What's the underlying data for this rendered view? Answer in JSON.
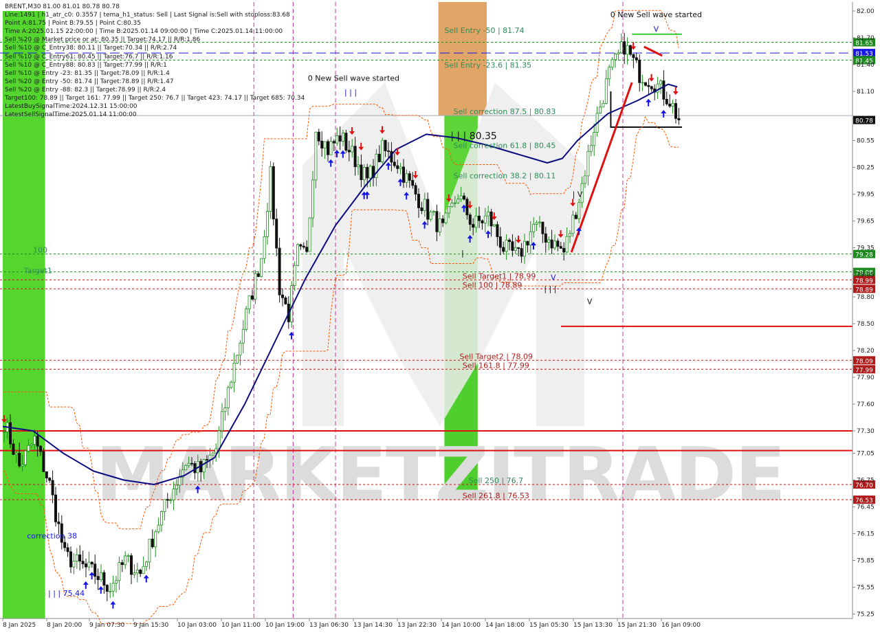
{
  "header": {
    "symbol_line": "BRENT,M30  81.00 81.01 80.78 80.78",
    "info_lines": [
      "Line:1491  |  h1_atr_c0: 0.3557  |  tema_h1_status: Sell  |  Last Signal is:Sell with stoploss:83.68",
      "Point A:81.75  |  Point B:79.55  |  Point C:80.35",
      "Time A:2025.01.15 22:00:00  |  Time B:2025.01.14 09:00:00  |  Time C:2025.01.14 11:00:00",
      "Sell %20 @ Market price or at: 80.35  ||  Target:74.17  ||  R/R:1.86",
      "Sell %10 @ C_Entry38: 80.11  ||  Target:70.34  ||  R/R:2.74",
      "Sell %10 @ C_Entry61: 80.45  ||  Target:76.7  ||  R/R:1.16",
      "Sell %10 @ C_Entry88: 80.83  ||  Target:77.99  ||  R/R:1",
      "Sell %10 @ Entry -23: 81.35  ||  Target:78.09  ||  R/R:1.4",
      "Sell %20 @ Entry -50: 81.74  ||  Target:78.89  ||  R/R:1.47",
      "Sell %20 @ Entry -88: 82.3  ||  Target:78.99  ||  R/R:2.4",
      "Target100: 78.89  ||  Target 161: 77.99  ||  Target 250: 76.7  ||  Target 423: 74.17  ||  Target 685: 70.34",
      "LatestBuySignalTime:2024.12.31 15:00:00",
      "LatestSellSignalTime:2025.01.14 11:00:00"
    ]
  },
  "chart_data": {
    "type": "candlestick",
    "symbol": "BRENT",
    "timeframe": "M30",
    "ylim": [
      75.2,
      82.1
    ],
    "y_ticks": [
      82.0,
      81.7,
      81.4,
      81.1,
      80.8,
      80.55,
      80.25,
      79.95,
      79.65,
      79.35,
      79.05,
      78.8,
      78.5,
      78.2,
      77.9,
      77.6,
      77.3,
      77.05,
      76.75,
      76.45,
      76.15,
      75.85,
      75.55,
      75.25
    ],
    "x_labels": [
      "8 Jan 2025",
      "8 Jan 20:00",
      "9 Jan 07:30",
      "9 Jan 15:30",
      "10 Jan 03:00",
      "10 Jan 11:00",
      "10 Jan 19:00",
      "13 Jan 06:30",
      "13 Jan 14:30",
      "13 Jan 22:30",
      "14 Jan 10:00",
      "14 Jan 18:00",
      "15 Jan 05:30",
      "15 Jan 13:30",
      "15 Jan 21:30",
      "16 Jan 09:00"
    ],
    "close_path": [
      [
        0,
        77.4
      ],
      [
        5,
        76.9
      ],
      [
        10,
        77.2
      ],
      [
        15,
        76.7
      ],
      [
        20,
        75.9
      ],
      [
        25,
        75.8
      ],
      [
        30,
        75.7
      ],
      [
        35,
        75.55
      ],
      [
        40,
        75.85
      ],
      [
        45,
        75.7
      ],
      [
        50,
        76.2
      ],
      [
        55,
        76.6
      ],
      [
        60,
        76.95
      ],
      [
        65,
        76.85
      ],
      [
        70,
        77.1
      ],
      [
        75,
        77.9
      ],
      [
        80,
        78.6
      ],
      [
        85,
        79.25
      ],
      [
        88,
        80.15
      ],
      [
        91,
        78.9
      ],
      [
        94,
        78.6
      ],
      [
        97,
        79.3
      ],
      [
        100,
        79.25
      ],
      [
        103,
        80.7
      ],
      [
        107,
        80.45
      ],
      [
        111,
        80.6
      ],
      [
        115,
        80.4
      ],
      [
        120,
        80.1
      ],
      [
        125,
        80.45
      ],
      [
        130,
        80.3
      ],
      [
        135,
        80.0
      ],
      [
        140,
        79.75
      ],
      [
        145,
        79.55
      ],
      [
        150,
        79.95
      ],
      [
        155,
        79.6
      ],
      [
        160,
        79.7
      ],
      [
        165,
        79.35
      ],
      [
        170,
        79.25
      ],
      [
        175,
        79.6
      ],
      [
        180,
        79.45
      ],
      [
        185,
        79.3
      ],
      [
        190,
        79.9
      ],
      [
        195,
        80.7
      ],
      [
        200,
        81.3
      ],
      [
        205,
        81.62
      ],
      [
        210,
        81.3
      ],
      [
        215,
        81.2
      ],
      [
        220,
        81.0
      ],
      [
        223,
        80.78
      ]
    ],
    "trend_line": [
      [
        0,
        77.35
      ],
      [
        10,
        77.3
      ],
      [
        20,
        77.05
      ],
      [
        30,
        76.85
      ],
      [
        40,
        76.75
      ],
      [
        50,
        76.7
      ],
      [
        60,
        76.8
      ],
      [
        70,
        77.0
      ],
      [
        80,
        77.6
      ],
      [
        90,
        78.3
      ],
      [
        100,
        79.0
      ],
      [
        110,
        79.6
      ],
      [
        120,
        80.05
      ],
      [
        130,
        80.45
      ],
      [
        140,
        80.62
      ],
      [
        150,
        80.58
      ],
      [
        160,
        80.5
      ],
      [
        170,
        80.4
      ],
      [
        180,
        80.3
      ],
      [
        185,
        80.35
      ],
      [
        190,
        80.55
      ],
      [
        200,
        80.85
      ],
      [
        210,
        81.0
      ],
      [
        220,
        81.18
      ],
      [
        223,
        81.15
      ]
    ],
    "zones": [
      {
        "kind": "buy-zone",
        "from_bar": 0,
        "to_bar": 14,
        "bottom": 75.2,
        "top": 82.0,
        "color": "#4cd423"
      },
      {
        "kind": "entry-zone",
        "from_bar": 144,
        "to_bar": 160,
        "bottom": 80.83,
        "top": 82.1,
        "color": "#e0a060"
      },
      {
        "kind": "target-zone",
        "from_bar": 146,
        "to_bar": 157,
        "bottom": 76.53,
        "top": 80.83,
        "color": "#44cc22"
      }
    ],
    "horizontal_lines": [
      {
        "price": 81.65,
        "label": "81.65",
        "color": "#1c8a1c",
        "style": "dotted"
      },
      {
        "price": 81.53,
        "label": "81.53",
        "color": "#1515e6",
        "style": "dashed"
      },
      {
        "price": 81.45,
        "label": "81.45",
        "color": "#1c8a1c",
        "style": "dotted"
      },
      {
        "price": 80.83,
        "label": "",
        "color": "#99aabb",
        "style": "solid"
      },
      {
        "price": 79.28,
        "label": "79.28",
        "color": "#1c8a1c",
        "style": "dotted"
      },
      {
        "price": 79.08,
        "label": "79.08",
        "color": "#1c8a1c",
        "style": "dotted"
      },
      {
        "price": 78.99,
        "label": "78.99",
        "color": "#b01c1c",
        "style": "dotted"
      },
      {
        "price": 78.89,
        "label": "78.89",
        "color": "#b01c1c",
        "style": "dotted"
      },
      {
        "price": 78.09,
        "label": "78.09",
        "color": "#b01c1c",
        "style": "dotted"
      },
      {
        "price": 77.99,
        "label": "77.99",
        "color": "#b01c1c",
        "style": "dotted"
      },
      {
        "price": 77.3,
        "label": "",
        "color": "#e01010",
        "style": "solid"
      },
      {
        "price": 77.08,
        "label": "",
        "color": "#e01010",
        "style": "solid"
      },
      {
        "price": 76.7,
        "label": "76.70",
        "color": "#b01c1c",
        "style": "dotted"
      },
      {
        "price": 76.53,
        "label": "76.53",
        "color": "#b01c1c",
        "style": "dotted"
      }
    ],
    "current_price": {
      "price": 80.78,
      "label": "80.78"
    },
    "price_levels_text": [
      {
        "text": "Sell Entry -50 | 81.74",
        "price": 81.74,
        "bar": 146,
        "color": "#2e8b57"
      },
      {
        "text": "Sell Entry -23.6 | 81.35",
        "price": 81.35,
        "bar": 146,
        "color": "#2e8b57"
      },
      {
        "text": "Sell correction 87.5 | 80.83",
        "price": 80.83,
        "bar": 149,
        "color": "#2e8b57"
      },
      {
        "text": "| | | 80.35",
        "price": 80.55,
        "bar": 148,
        "color": "#111111"
      },
      {
        "text": "Sell correction 61.8 | 80.45",
        "price": 80.45,
        "bar": 149,
        "color": "#2e8b57"
      },
      {
        "text": "Sell correction 38.2 | 80.11",
        "price": 80.11,
        "bar": 149,
        "color": "#2e8b57"
      },
      {
        "text": "Sell Target1 | 78.99",
        "price": 78.99,
        "bar": 152,
        "color": "#b01c1c"
      },
      {
        "text": "Sell 100 | 78.89",
        "price": 78.89,
        "bar": 152,
        "color": "#b01c1c"
      },
      {
        "text": "Sell Target2 | 78.09",
        "price": 78.09,
        "bar": 151,
        "color": "#b01c1c"
      },
      {
        "text": "Sell 161.8 | 77.99",
        "price": 77.99,
        "bar": 152,
        "color": "#b01c1c"
      },
      {
        "text": "Sell 250 | 76.7",
        "price": 76.7,
        "bar": 154,
        "color": "#2e8b57"
      },
      {
        "text": "Sell 261.8 | 76.53",
        "price": 76.53,
        "bar": 152,
        "color": "#b01c1c"
      },
      {
        "text": "100",
        "price": 79.28,
        "bar": 10,
        "color": "#2e8b57"
      },
      {
        "text": "Target1",
        "price": 79.05,
        "bar": 7,
        "color": "#2e8b57"
      },
      {
        "text": "correction 38",
        "price": 76.08,
        "bar": 8,
        "color": "#1515e6"
      },
      {
        "text": "| | | 75.44",
        "price": 75.44,
        "bar": 15,
        "color": "#1515e6"
      }
    ],
    "wave_labels": [
      {
        "text": "0 New Sell wave started",
        "price": 81.93,
        "bar": 216,
        "color": "#111111"
      },
      {
        "text": "0 New Sell wave started",
        "price": 81.22,
        "bar": 116,
        "color": "#111111"
      },
      {
        "text": "| | |",
        "price": 81.06,
        "bar": 115,
        "color": "#1515e6"
      },
      {
        "text": "| V",
        "price": 79.92,
        "bar": 190,
        "color": "#111111"
      },
      {
        "text": "| | |",
        "price": 78.86,
        "bar": 181,
        "color": "#111111"
      },
      {
        "text": "V",
        "price": 78.72,
        "bar": 194,
        "color": "#111111"
      },
      {
        "text": "V",
        "price": 78.99,
        "bar": 182,
        "color": "#1515e6"
      },
      {
        "text": "V",
        "price": 81.77,
        "bar": 216,
        "color": "#1515e6"
      },
      {
        "text": "|",
        "price": 79.26,
        "bar": 152,
        "color": "#111111"
      }
    ],
    "watermark": "MARKETZITRADE",
    "colors": {
      "bull": "#1e8c1e",
      "bear": "#111111",
      "trend": "#0a0a80",
      "envelope": "#ff5500",
      "accent_red": "#e01010",
      "buy_arrow": "#1515e6",
      "sell_arrow": "#e01010"
    }
  }
}
